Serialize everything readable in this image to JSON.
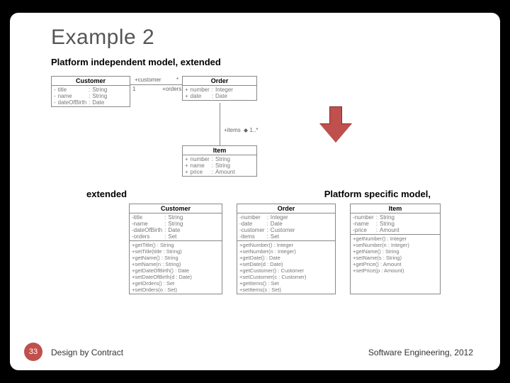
{
  "title": "Example 2",
  "subtitle_pim": "Platform independent model, extended",
  "label_psm_right": "Platform specific model,",
  "label_extended_left": "extended",
  "footer_left": "Design by Contract",
  "footer_right": "Software Engineering, 2012",
  "page_number": "33",
  "pim": {
    "customer": {
      "name": "Customer",
      "attrs": [
        {
          "vis": "-",
          "name": "title",
          "type": "String"
        },
        {
          "vis": "-",
          "name": "name",
          "type": "String"
        },
        {
          "vis": "-",
          "name": "dateOfBirth",
          "type": "Date"
        }
      ]
    },
    "order": {
      "name": "Order",
      "attrs": [
        {
          "vis": "+",
          "name": "number",
          "type": "Integer"
        },
        {
          "vis": "+",
          "name": "date",
          "type": "Date"
        }
      ]
    },
    "item": {
      "name": "Item",
      "attrs": [
        {
          "vis": "+",
          "name": "number",
          "type": "String"
        },
        {
          "vis": "+",
          "name": "name",
          "type": "String"
        },
        {
          "vis": "+",
          "name": "price",
          "type": "Amount"
        }
      ]
    },
    "assoc_customer_orders": {
      "role1": "+customer",
      "mult1": "1",
      "role2": "+orders",
      "mult2": "*"
    },
    "assoc_order_items": {
      "role": "+items",
      "mult": "1..*"
    }
  },
  "psm": {
    "customer": {
      "name": "Customer",
      "attrs": [
        {
          "name": "-title",
          "type": "String"
        },
        {
          "name": "-name",
          "type": "String"
        },
        {
          "name": "-dateOfBirth",
          "type": "Date"
        },
        {
          "name": "-orders",
          "type": "Set"
        }
      ],
      "ops": [
        "+getTitle() : String",
        "+setTitle(title : String)",
        "+getName() : String",
        "+setName(n : String)",
        "+getDateOfBirth() : Date",
        "+setDateOfBirth(d : Date)",
        "+getOrders() : Set",
        "+setOrders(o : Set)"
      ]
    },
    "order": {
      "name": "Order",
      "attrs": [
        {
          "name": "-number",
          "type": "Integer"
        },
        {
          "name": "-date",
          "type": "Date"
        },
        {
          "name": "-customer",
          "type": "Customer"
        },
        {
          "name": "-items",
          "type": "Set"
        }
      ],
      "ops": [
        "+getNumber() : Integer",
        "+setNumber(n : Integer)",
        "+getDate() : Date",
        "+setDate(d : Date)",
        "+getCustomer() : Customer",
        "+setCustomer(c : Customer)",
        "+getItems() : Set",
        "+setItems(s : Set)"
      ]
    },
    "item": {
      "name": "Item",
      "attrs": [
        {
          "name": "-number",
          "type": "String"
        },
        {
          "name": "-name",
          "type": "String"
        },
        {
          "name": "-price",
          "type": "Amount"
        }
      ],
      "ops": [
        "+getNumber() : Integer",
        "+setNumber(n : Integer)",
        "+getName() : String",
        "+setName(s : String)",
        "+getPrice() : Amount",
        "+setPrice(p : Amount)"
      ]
    }
  }
}
